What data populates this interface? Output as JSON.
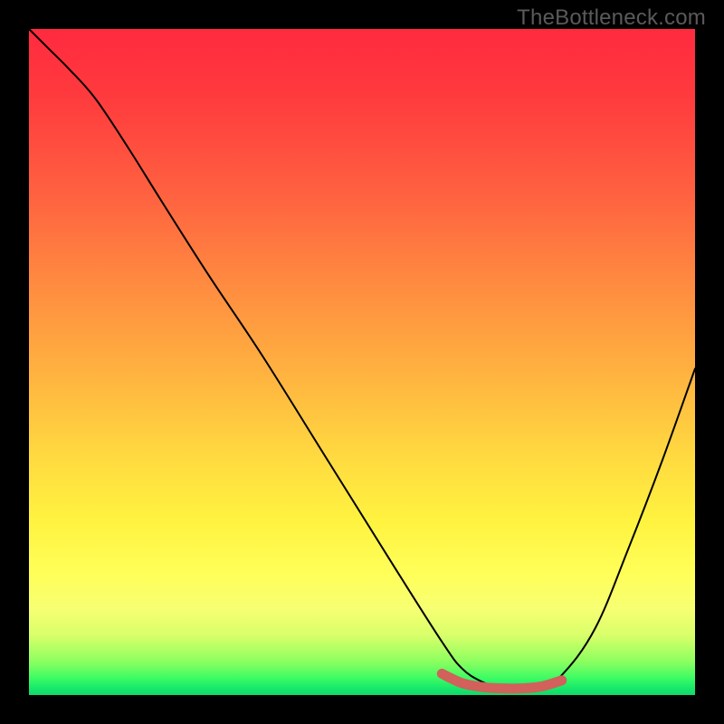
{
  "watermark": "TheBottleneck.com",
  "chart_data": {
    "type": "line",
    "title": "",
    "xlabel": "",
    "ylabel": "",
    "xlim": [
      0,
      100
    ],
    "ylim": [
      0,
      100
    ],
    "curve": {
      "name": "bottleneck-curve",
      "color": "#000000",
      "x": [
        0,
        3,
        6,
        10,
        15,
        20,
        27,
        35,
        45,
        55,
        62,
        65,
        68,
        71,
        74,
        77,
        80,
        85,
        90,
        95,
        100
      ],
      "y": [
        100,
        97,
        94,
        89.5,
        82,
        74,
        63,
        51,
        35,
        19,
        8,
        4,
        2,
        1,
        1,
        1.5,
        3,
        10,
        22,
        35,
        49
      ]
    },
    "valley_marker": {
      "color": "#d1615a",
      "x": [
        62,
        65,
        68,
        71,
        74,
        77,
        80
      ],
      "y": [
        3.2,
        1.8,
        1.2,
        1.0,
        1.0,
        1.3,
        2.2
      ]
    }
  },
  "colors": {
    "page_bg": "#000000",
    "gradient_top": "#ff2a3f",
    "gradient_mid": "#fff340",
    "gradient_bottom": "#11d96b",
    "marker": "#d1615a",
    "watermark": "#5a5a5a"
  }
}
